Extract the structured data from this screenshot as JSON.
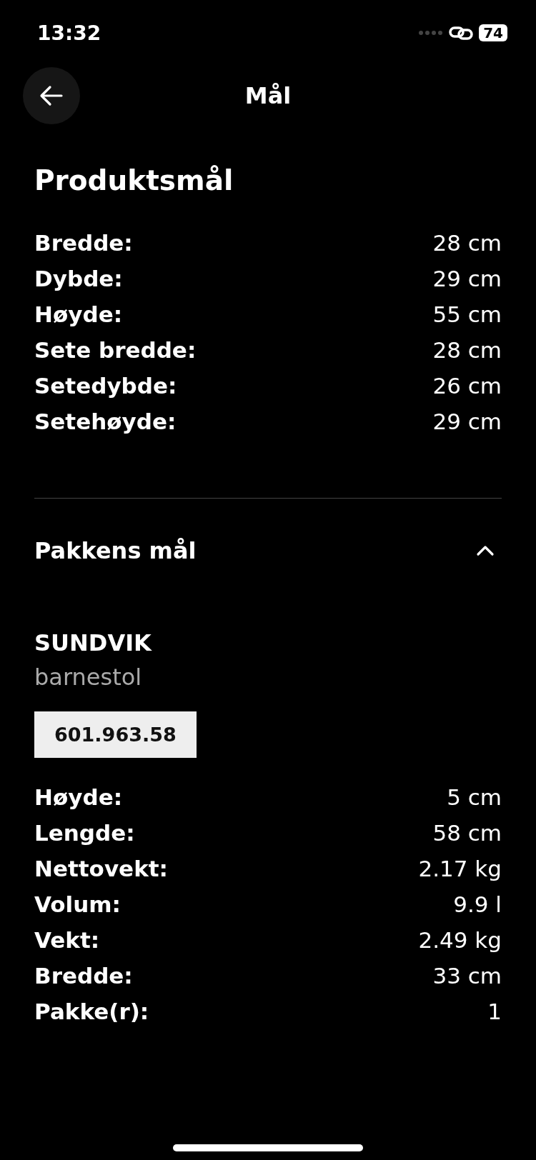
{
  "status_bar": {
    "time": "13:32",
    "battery": "74"
  },
  "header": {
    "title": "Mål"
  },
  "product_dimensions": {
    "title": "Produktsmål",
    "rows": [
      {
        "label": "Bredde:",
        "value": "28 cm"
      },
      {
        "label": "Dybde:",
        "value": "29 cm"
      },
      {
        "label": "Høyde:",
        "value": "55 cm"
      },
      {
        "label": "Sete bredde:",
        "value": "28 cm"
      },
      {
        "label": "Setedybde:",
        "value": "26 cm"
      },
      {
        "label": "Setehøyde:",
        "value": "29 cm"
      }
    ]
  },
  "package_dimensions": {
    "title": "Pakkens mål",
    "expanded": true,
    "product_name": "SUNDVIK",
    "product_type": "barnestol",
    "article_number": "601.963.58",
    "rows": [
      {
        "label": "Høyde:",
        "value": "5 cm"
      },
      {
        "label": "Lengde:",
        "value": "58 cm"
      },
      {
        "label": "Nettovekt:",
        "value": "2.17 kg"
      },
      {
        "label": "Volum:",
        "value": "9.9 l"
      },
      {
        "label": "Vekt:",
        "value": "2.49 kg"
      },
      {
        "label": "Bredde:",
        "value": "33 cm"
      },
      {
        "label": "Pakke(r):",
        "value": "1"
      }
    ]
  }
}
